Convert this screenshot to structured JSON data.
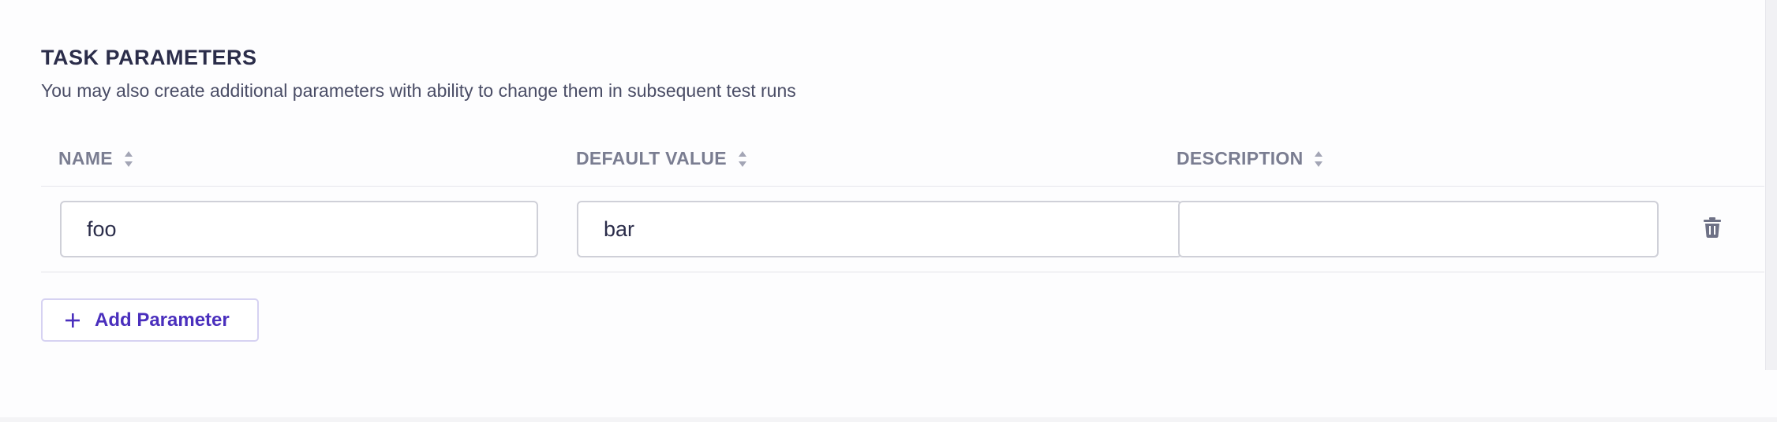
{
  "section": {
    "title": "TASK PARAMETERS",
    "subtitle": "You may also create additional parameters with ability to change them in subsequent test runs"
  },
  "table": {
    "columns": [
      {
        "label": "NAME",
        "sort_icon": "sort-icon"
      },
      {
        "label": "DEFAULT VALUE",
        "sort_icon": "sort-icon"
      },
      {
        "label": "DESCRIPTION",
        "sort_icon": "sort-icon"
      }
    ],
    "rows": [
      {
        "name": "foo",
        "default_value": "bar",
        "description": "",
        "delete_icon": "trash-icon"
      }
    ]
  },
  "add_button": {
    "label": "Add Parameter",
    "icon": "plus-icon"
  },
  "colors": {
    "accent": "#4a2fbd",
    "heading": "#2b2d4a",
    "muted": "#7a7d91",
    "border": "#cfd0d8"
  }
}
